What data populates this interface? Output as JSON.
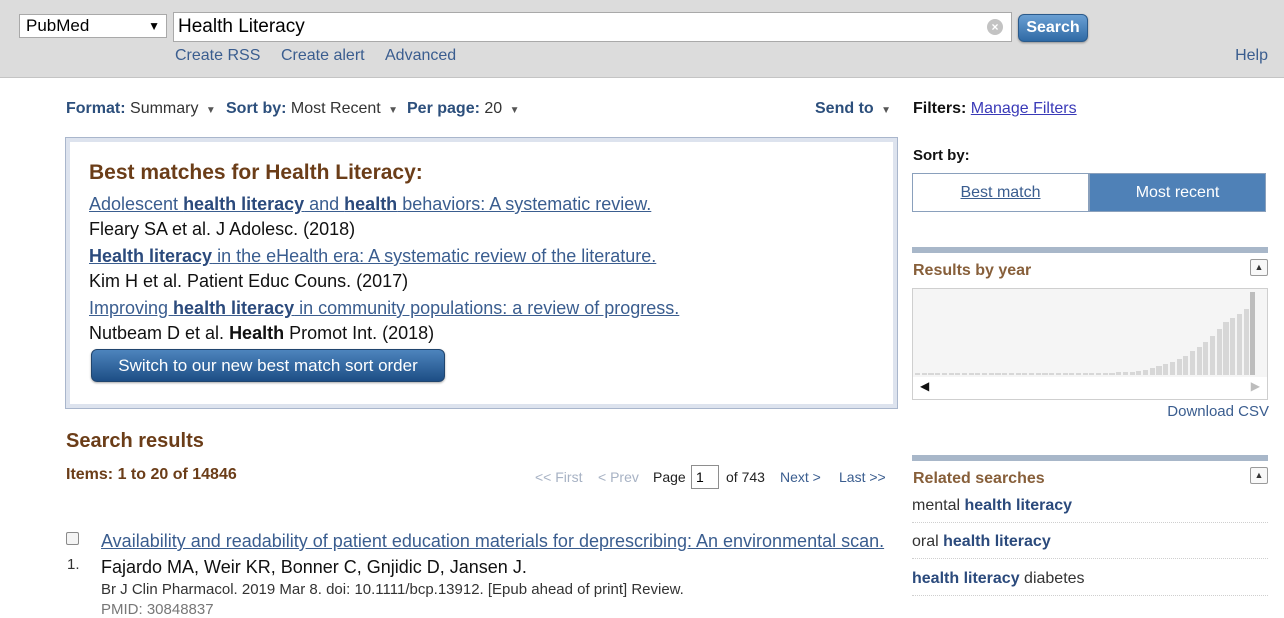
{
  "header": {
    "database": "PubMed",
    "search_value": "Health Literacy",
    "search_button": "Search",
    "links": [
      "Create RSS",
      "Create alert",
      "Advanced"
    ],
    "help": "Help"
  },
  "display": {
    "format_label": "Format",
    "format_value": "Summary",
    "sort_label": "Sort by",
    "sort_value": "Most Recent",
    "perpage_label": "Per page",
    "perpage_value": "20",
    "send_to": "Send to"
  },
  "best_match": {
    "title": "Best matches for Health Literacy:",
    "items": [
      {
        "parts": [
          {
            "t": "Adolescent ",
            "b": false
          },
          {
            "t": "health literacy",
            "b": true
          },
          {
            "t": " and ",
            "b": false
          },
          {
            "t": "health",
            "b": true
          },
          {
            "t": " behaviors: A systematic review.",
            "b": false
          }
        ],
        "cite": "Fleary SA et al. J Adolesc. (2018)"
      },
      {
        "parts": [
          {
            "t": "Health literacy",
            "b": true
          },
          {
            "t": " in the eHealth era: A systematic review of the literature.",
            "b": false
          }
        ],
        "cite": "Kim H et al. Patient Educ Couns. (2017)"
      },
      {
        "parts": [
          {
            "t": "Improving ",
            "b": false
          },
          {
            "t": "health literacy",
            "b": true
          },
          {
            "t": " in community populations: a review of progress.",
            "b": false
          }
        ],
        "cite_parts": [
          {
            "t": "Nutbeam D et al. ",
            "b": false
          },
          {
            "t": "Health",
            "b": true
          },
          {
            "t": " Promot Int. (2018)",
            "b": false
          }
        ]
      }
    ],
    "switch_button": "Switch to our new best match sort order"
  },
  "results": {
    "heading": "Search results",
    "count": "Items: 1 to 20 of 14846",
    "pager": {
      "first": "<< First",
      "prev": "< Prev",
      "page_label": "Page",
      "page_value": "1",
      "of": "of 743",
      "next": "Next >",
      "last": "Last >>"
    },
    "articles": [
      {
        "num": "1.",
        "title": "Availability and readability of patient education materials for deprescribing: An environmental scan.",
        "authors": "Fajardo MA, Weir KR, Bonner C, Gnjidic D, Jansen J.",
        "source": "Br J Clin Pharmacol. 2019 Mar 8. doi: 10.1111/bcp.13912. [Epub ahead of print] Review.",
        "pmid": "PMID: 30848837"
      }
    ]
  },
  "sidebar": {
    "filters_label": "Filters:",
    "manage_filters": "Manage Filters",
    "sort_by": "Sort by:",
    "sort_options": [
      "Best match",
      "Most recent"
    ],
    "results_by_year": "Results by year",
    "download_csv": "Download CSV",
    "related_heading": "Related searches",
    "related": [
      [
        {
          "t": "mental ",
          "b": false
        },
        {
          "t": "health literacy",
          "b": true
        }
      ],
      [
        {
          "t": "oral ",
          "b": false
        },
        {
          "t": "health literacy",
          "b": true
        }
      ],
      [
        {
          "t": "health literacy",
          "b": true
        },
        {
          "t": " diabetes",
          "b": false
        }
      ]
    ]
  },
  "chart_data": {
    "type": "bar",
    "values": [
      2,
      2,
      2,
      2,
      2,
      2,
      2,
      2,
      2,
      2,
      2,
      2,
      2,
      2,
      2,
      2,
      2,
      2,
      2,
      2,
      2,
      2,
      2,
      2,
      2,
      2,
      2,
      2,
      2,
      2,
      3,
      3,
      3,
      4,
      5,
      7,
      9,
      11,
      13,
      16,
      19,
      23,
      27,
      32,
      38,
      45,
      52,
      56,
      60,
      64,
      81
    ],
    "ylim": [
      0,
      84
    ]
  },
  "icons": {
    "select_caret": "▼",
    "clear": "×",
    "dropdown": "▼",
    "collapse": "▲",
    "left": "◀",
    "right": "▶"
  }
}
